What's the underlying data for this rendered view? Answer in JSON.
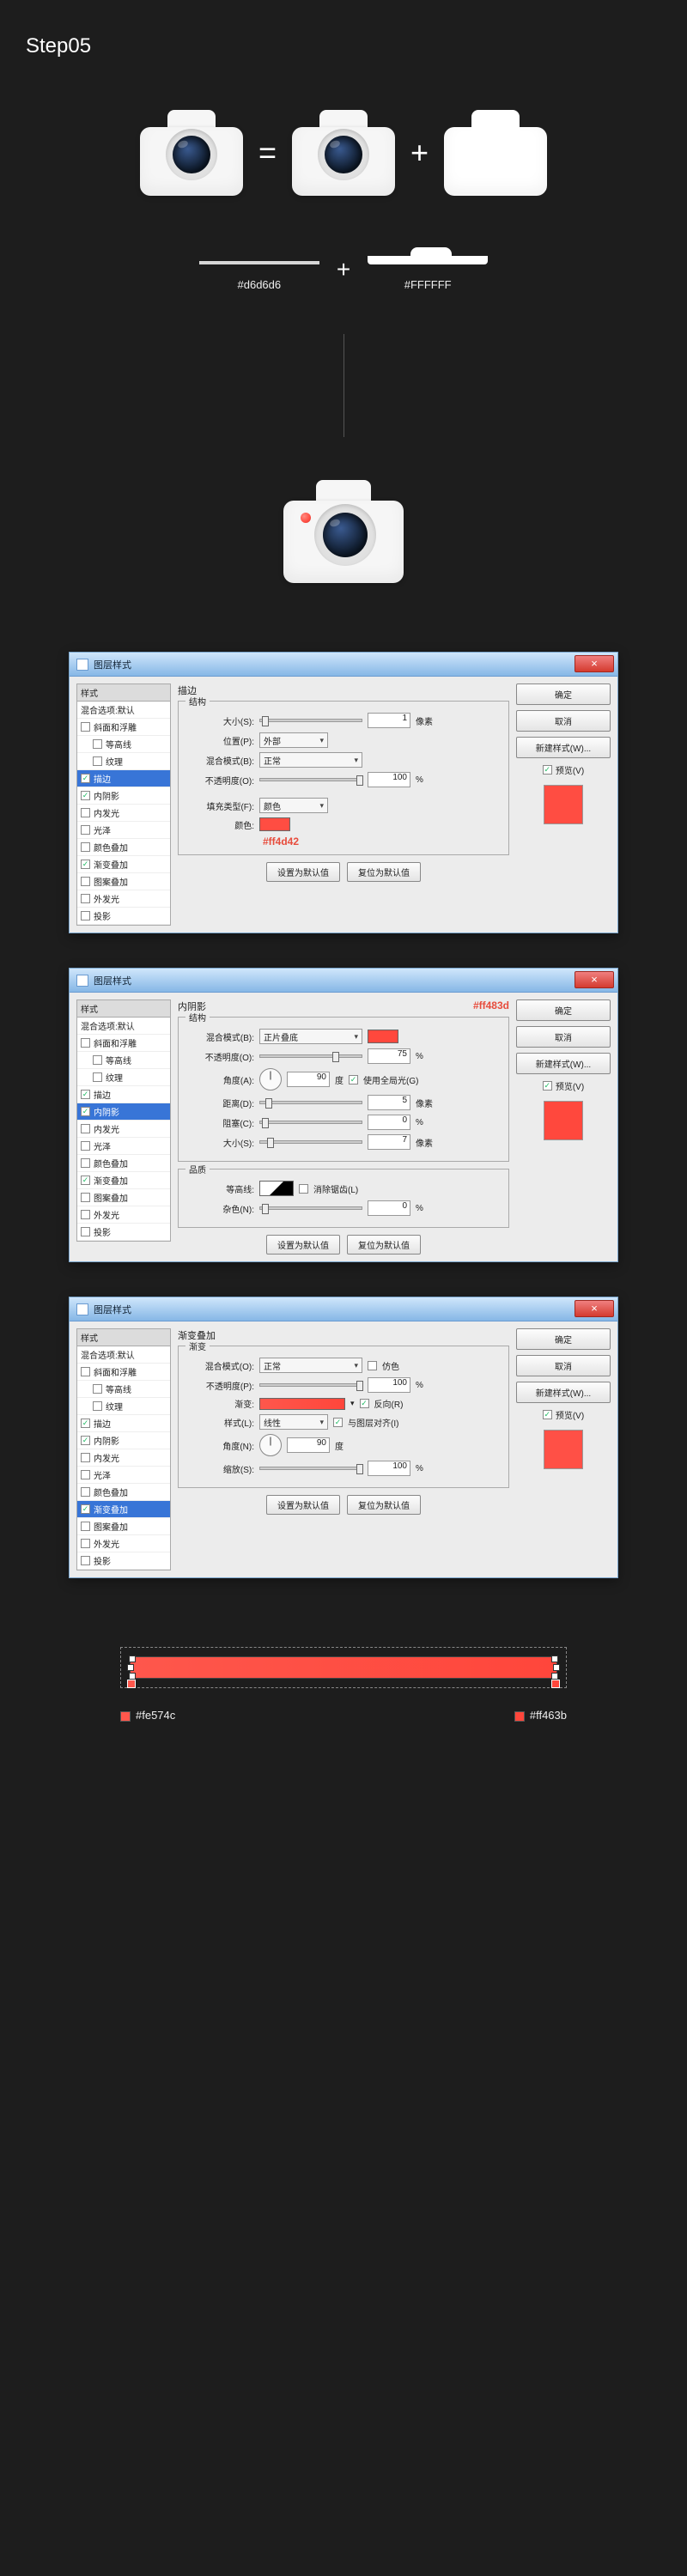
{
  "step_title": "Step05",
  "equation": {
    "equals": "=",
    "plus": "+"
  },
  "row2": {
    "plus": "+",
    "gray_hex": "#d6d6d6",
    "white_hex": "#FFFFFF"
  },
  "dialogs": {
    "common": {
      "window_title": "图层样式",
      "close": "×",
      "left_header": "样式",
      "blend_default": "混合选项:默认",
      "ok": "确定",
      "cancel": "取消",
      "new_style": "新建样式(W)...",
      "preview": "预览(V)",
      "make_default": "设置为默认值",
      "reset_default": "复位为默认值"
    },
    "left_effects": [
      {
        "label": "斜面和浮雕",
        "chk": false
      },
      {
        "label": "等高线",
        "chk": false,
        "indent": true
      },
      {
        "label": "纹理",
        "chk": false,
        "indent": true
      },
      {
        "label": "描边",
        "chk": true
      },
      {
        "label": "内阴影",
        "chk": true
      },
      {
        "label": "内发光",
        "chk": false
      },
      {
        "label": "光泽",
        "chk": false
      },
      {
        "label": "颜色叠加",
        "chk": false
      },
      {
        "label": "渐变叠加",
        "chk": true
      },
      {
        "label": "图案叠加",
        "chk": false
      },
      {
        "label": "外发光",
        "chk": false
      },
      {
        "label": "投影",
        "chk": false
      }
    ],
    "d1": {
      "selected_index": 3,
      "panel_title": "描边",
      "group_title": "结构",
      "size_label": "大小(S):",
      "size_val": "1",
      "size_unit": "像素",
      "pos_label": "位置(P):",
      "pos_val": "外部",
      "blend_label": "混合模式(B):",
      "blend_val": "正常",
      "opacity_label": "不透明度(O):",
      "opacity_val": "100",
      "pct": "%",
      "filltype_label": "填充类型(F):",
      "filltype_val": "颜色",
      "color_label": "颜色:",
      "annot": "#ff4d42",
      "preview_color": "#ff4d42"
    },
    "d2": {
      "selected_index": 4,
      "panel_title": "内阴影",
      "group_title": "结构",
      "annot": "#ff483d",
      "blend_label": "混合模式(B):",
      "blend_val": "正片叠底",
      "swatch_color": "#ff483d",
      "opacity_label": "不透明度(O):",
      "opacity_val": "75",
      "pct": "%",
      "angle_label": "角度(A):",
      "angle_val": "90",
      "deg": "度",
      "global_label": "使用全局光(G)",
      "dist_label": "距离(D):",
      "dist_val": "5",
      "dist_unit": "像素",
      "choke_label": "阻塞(C):",
      "choke_val": "0",
      "choke_unit": "%",
      "size_label": "大小(S):",
      "size_val": "7",
      "size_unit": "像素",
      "quality_group": "品质",
      "contour_label": "等高线:",
      "anti_label": "消除锯齿(L)",
      "noise_label": "杂色(N):",
      "noise_val": "0",
      "noise_unit": "%",
      "preview_color": "#ff483d"
    },
    "d3": {
      "selected_index": 8,
      "panel_title": "渐变叠加",
      "group_title": "渐变",
      "blend_label": "混合模式(O):",
      "blend_val": "正常",
      "dither_label": "仿色",
      "opacity_label": "不透明度(P):",
      "opacity_val": "100",
      "pct": "%",
      "grad_label": "渐变:",
      "reverse_label": "反向(R)",
      "style_label": "样式(L):",
      "style_val": "线性",
      "align_label": "与图层对齐(I)",
      "angle_label": "角度(N):",
      "angle_val": "90",
      "deg": "度",
      "scale_label": "缩放(S):",
      "scale_val": "100",
      "scale_unit": "%",
      "preview_color": "#ff5046"
    }
  },
  "bottom": {
    "left_hex": "#fe574c",
    "right_hex": "#ff463b"
  }
}
